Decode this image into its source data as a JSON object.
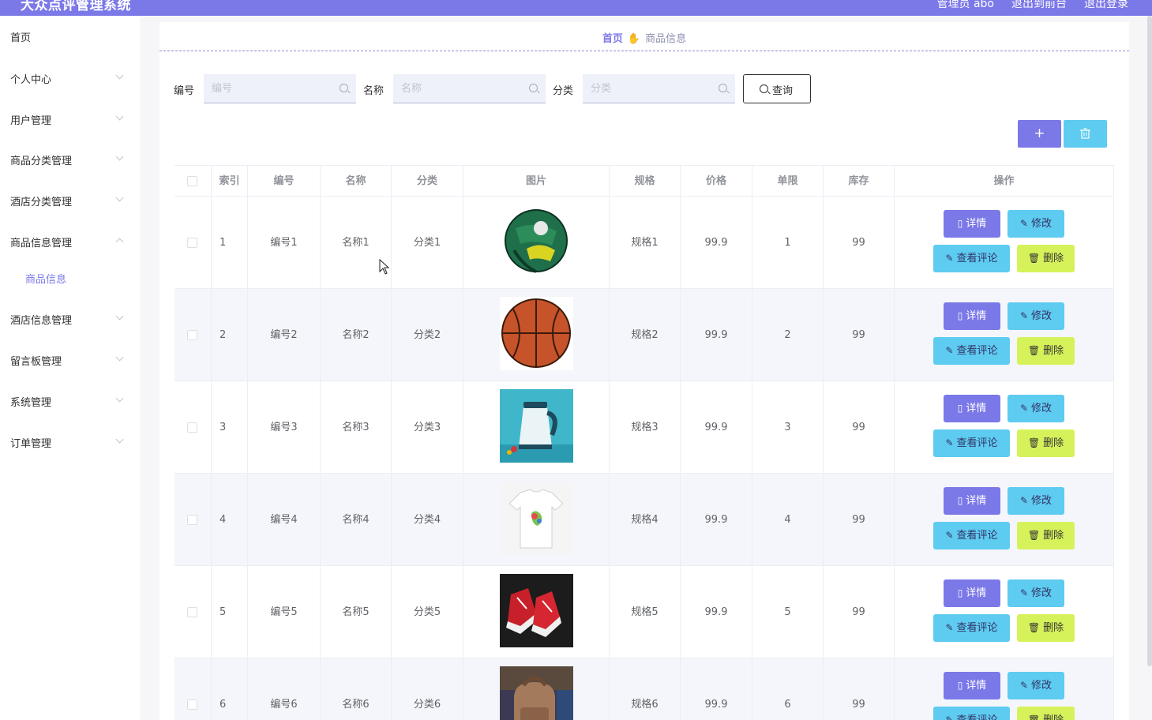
{
  "header": {
    "title": "大众点评管理系统",
    "links": [
      "管理员 abo",
      "退出到前台",
      "退出登录"
    ],
    "color": "#7b78e8"
  },
  "sidebar": {
    "items": [
      {
        "label": "首页",
        "chevron": ""
      },
      {
        "label": "个人中心",
        "chevron": "down"
      },
      {
        "label": "用户管理",
        "chevron": "down"
      },
      {
        "label": "商品分类管理",
        "chevron": "down"
      },
      {
        "label": "酒店分类管理",
        "chevron": "down"
      },
      {
        "label": "商品信息管理",
        "chevron": "up"
      },
      {
        "label": "商品信息",
        "chevron": "",
        "sub": true
      },
      {
        "label": "酒店信息管理",
        "chevron": "down"
      },
      {
        "label": "留言板管理",
        "chevron": "down"
      },
      {
        "label": "系统管理",
        "chevron": "down"
      },
      {
        "label": "订单管理",
        "chevron": "down"
      }
    ]
  },
  "breadcrumb": {
    "home": "首页",
    "current": "商品信息"
  },
  "search": {
    "fields": [
      {
        "label": "编号",
        "placeholder": "编号",
        "value": ""
      },
      {
        "label": "名称",
        "placeholder": "名称",
        "value": ""
      },
      {
        "label": "分类",
        "placeholder": "分类",
        "value": ""
      }
    ],
    "query_label": "查询"
  },
  "toolbar": {
    "add_label": "+"
  },
  "table": {
    "headers": [
      "索引",
      "编号",
      "名称",
      "分类",
      "图片",
      "规格",
      "价格",
      "单限",
      "库存",
      "操作"
    ],
    "rows": [
      {
        "index": "1",
        "code": "编号1",
        "name": "名称1",
        "category": "分类1",
        "image": "soccer-ball",
        "spec": "规格1",
        "price": "99.9",
        "limit": "1",
        "stock": "99"
      },
      {
        "index": "2",
        "code": "编号2",
        "name": "名称2",
        "category": "分类2",
        "image": "basketball",
        "spec": "规格2",
        "price": "99.9",
        "limit": "2",
        "stock": "99"
      },
      {
        "index": "3",
        "code": "编号3",
        "name": "名称3",
        "category": "分类3",
        "image": "electric-kettle",
        "spec": "规格3",
        "price": "99.9",
        "limit": "3",
        "stock": "99"
      },
      {
        "index": "4",
        "code": "编号4",
        "name": "名称4",
        "category": "分类4",
        "image": "white-t-shirt",
        "spec": "规格4",
        "price": "99.9",
        "limit": "4",
        "stock": "99"
      },
      {
        "index": "5",
        "code": "编号5",
        "name": "名称5",
        "category": "分类5",
        "image": "red-sneakers",
        "spec": "规格5",
        "price": "99.9",
        "limit": "5",
        "stock": "99"
      },
      {
        "index": "6",
        "code": "编号6",
        "name": "名称6",
        "category": "分类6",
        "image": "backpack",
        "spec": "规格6",
        "price": "99.9",
        "limit": "6",
        "stock": "99"
      }
    ],
    "actions": {
      "detail": "详情",
      "edit": "修改",
      "review": "查看评论",
      "delete": "删除"
    }
  },
  "colors": {
    "primary": "#7b78e8",
    "info": "#5ecbf0",
    "warning": "#d6f25a"
  }
}
